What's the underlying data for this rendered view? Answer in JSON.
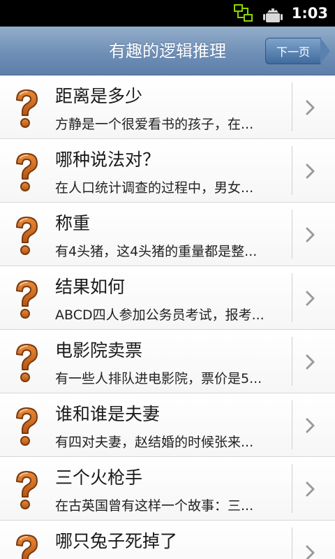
{
  "status_bar": {
    "time": "1:03",
    "icons": [
      "data-sync-icon",
      "android-debug-icon"
    ]
  },
  "header": {
    "title": "有趣的逻辑推理",
    "next_label": "下一页"
  },
  "list": {
    "icon": "question-mark-icon",
    "chevron": "chevron-right-icon",
    "items": [
      {
        "title": "距离是多少",
        "desc": "方静是一个很爱看书的孩子，在..."
      },
      {
        "title": "哪种说法对？",
        "desc": "在人口统计调查的过程中，男女..."
      },
      {
        "title": "称重",
        "desc": "有4头猪，这4头猪的重量都是整..."
      },
      {
        "title": "结果如何",
        "desc": "ABCD四人参加公务员考试，报考..."
      },
      {
        "title": "电影院卖票",
        "desc": "有一些人排队进电影院，票价是5..."
      },
      {
        "title": "谁和谁是夫妻",
        "desc": "有四对夫妻，赵结婚的时候张来..."
      },
      {
        "title": "三个火枪手",
        "desc": "在古英国曾有这样一个故事：三..."
      },
      {
        "title": "哪只兔子死掉了",
        "desc": ""
      }
    ]
  },
  "colors": {
    "header_gradient_top": "#94aecb",
    "header_gradient_bottom": "#5d7fa9",
    "icon_orange": "#d46a1e",
    "chevron_gray": "#9a9a9a"
  }
}
